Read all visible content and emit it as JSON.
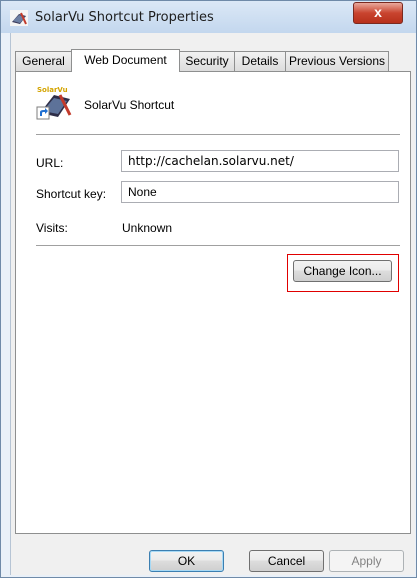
{
  "window": {
    "title": "SolarVu Shortcut Properties",
    "close_label": "x",
    "colors": {
      "close_button": "#c9442f",
      "highlight_box": "#e00000"
    }
  },
  "tabs": [
    {
      "label": "General",
      "active": false
    },
    {
      "label": "Web Document",
      "active": true
    },
    {
      "label": "Security",
      "active": false
    },
    {
      "label": "Details",
      "active": false
    },
    {
      "label": "Previous Versions",
      "active": false
    }
  ],
  "shortcut": {
    "icon": "solarvu-shortcut-icon",
    "icon_text": "SolarVu",
    "name": "SolarVu Shortcut"
  },
  "form": {
    "url_label": "URL:",
    "url_value": "http://cachelan.solarvu.net/",
    "shortcut_key_label": "Shortcut key:",
    "shortcut_key_value": "None",
    "visits_label": "Visits:",
    "visits_value": "Unknown"
  },
  "buttons": {
    "change_icon": "Change Icon...",
    "ok": "OK",
    "cancel": "Cancel",
    "apply": "Apply"
  }
}
